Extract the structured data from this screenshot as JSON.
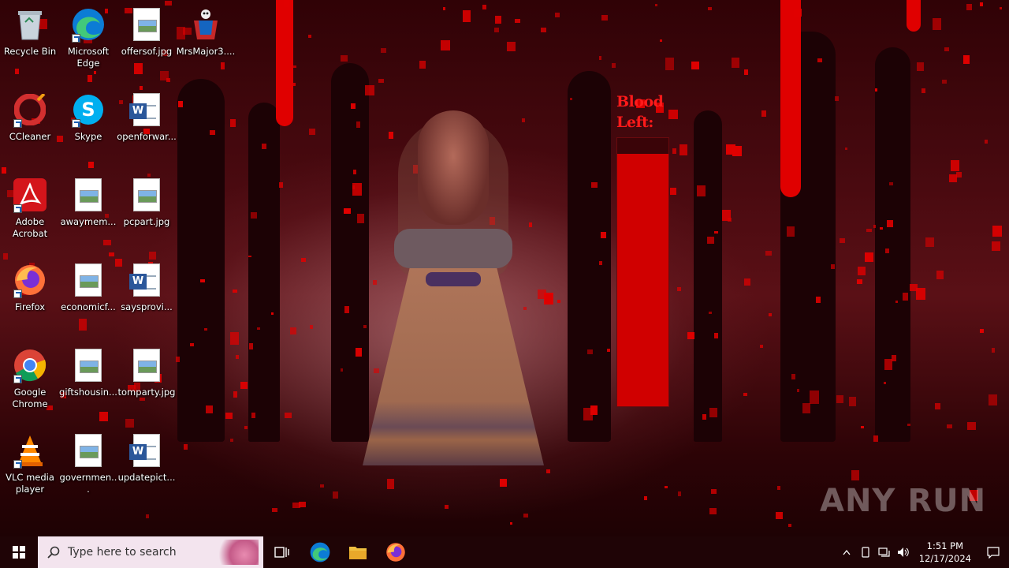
{
  "desktop": {
    "icons": [
      {
        "label": "Recycle Bin",
        "icon": "recycle-bin-icon"
      },
      {
        "label": "Microsoft Edge",
        "icon": "edge-icon"
      },
      {
        "label": "offersof.jpg",
        "icon": "image-file-icon"
      },
      {
        "label": "MrsMajor3....",
        "icon": "mrsmajor-icon"
      },
      {
        "label": "CCleaner",
        "icon": "ccleaner-icon"
      },
      {
        "label": "Skype",
        "icon": "skype-icon"
      },
      {
        "label": "openforwar...",
        "icon": "word-file-icon"
      },
      {
        "label": "Adobe Acrobat",
        "icon": "acrobat-icon"
      },
      {
        "label": "awaymem...",
        "icon": "image-file-icon"
      },
      {
        "label": "pcpart.jpg",
        "icon": "image-file-icon"
      },
      {
        "label": "Firefox",
        "icon": "firefox-icon"
      },
      {
        "label": "economicf...",
        "icon": "image-file-icon"
      },
      {
        "label": "saysprovi...",
        "icon": "word-file-icon"
      },
      {
        "label": "Google Chrome",
        "icon": "chrome-icon"
      },
      {
        "label": "giftshousin...",
        "icon": "image-file-icon"
      },
      {
        "label": "tomparty.jpg",
        "icon": "image-file-icon"
      },
      {
        "label": "VLC media player",
        "icon": "vlc-icon"
      },
      {
        "label": "governmen...",
        "icon": "image-file-icon"
      },
      {
        "label": "updatepict...",
        "icon": "word-file-icon"
      }
    ]
  },
  "blood_meter": {
    "label": "Blood Left:",
    "level_fraction": 0.94,
    "fill_color": "#d00000"
  },
  "watermark": "ANY RUN",
  "taskbar": {
    "search_placeholder": "Type here to search",
    "pinned": [
      "task-view-icon",
      "edge-icon",
      "file-explorer-icon",
      "firefox-icon"
    ],
    "clock_time": "1:51 PM",
    "clock_date": "12/17/2024"
  }
}
